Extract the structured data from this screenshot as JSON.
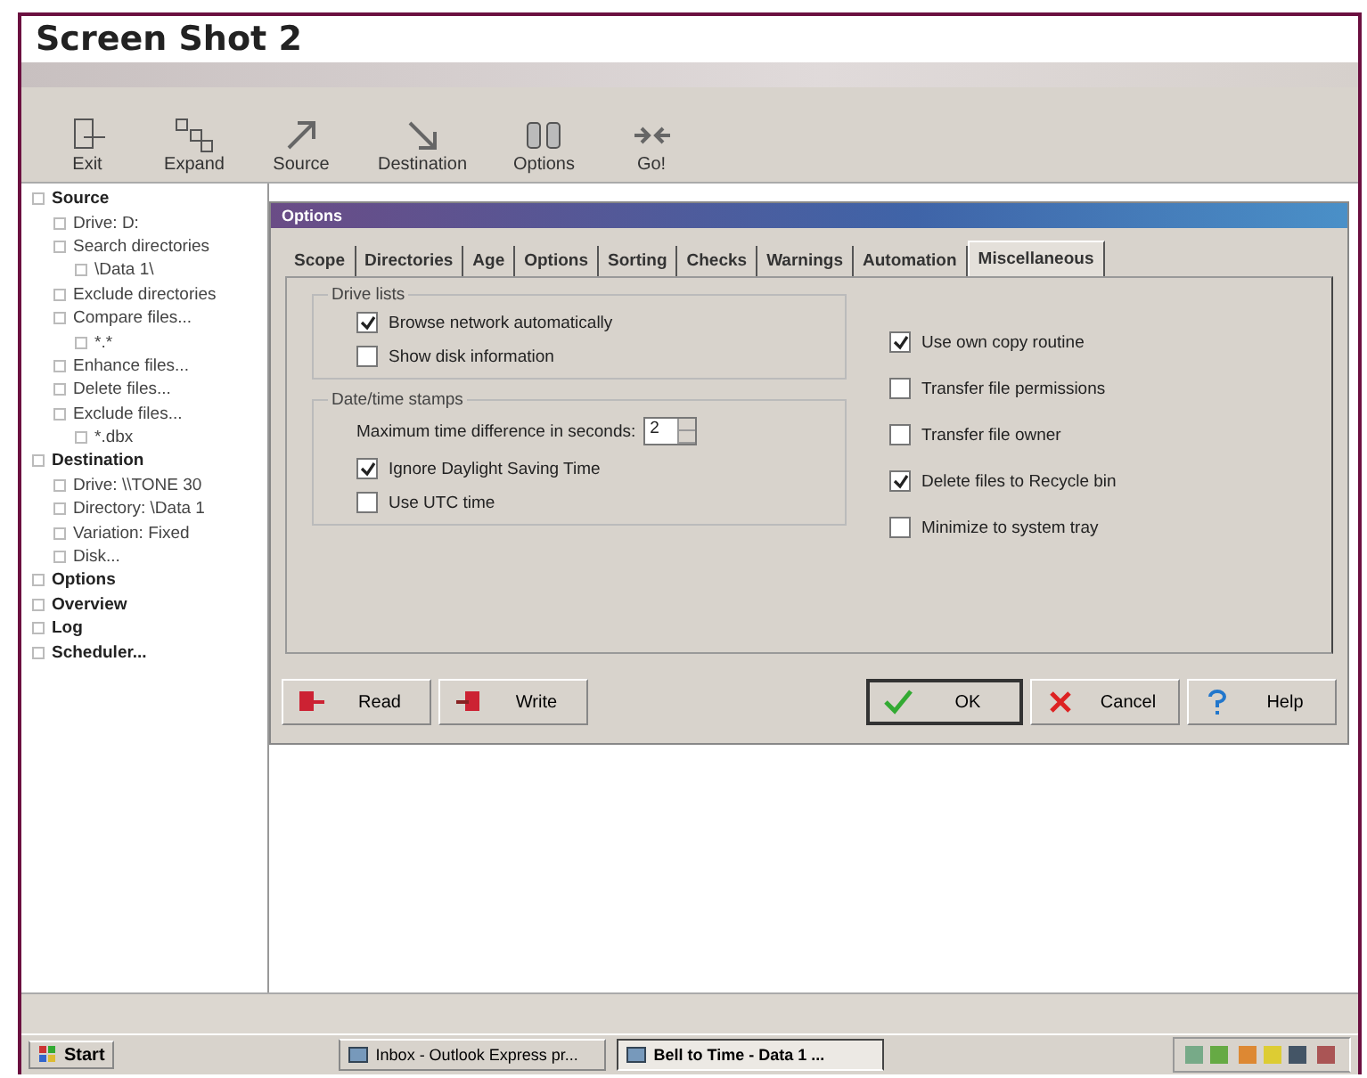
{
  "frame_title": "Screen Shot 2",
  "toolbar": [
    {
      "label": "Exit"
    },
    {
      "label": "Expand"
    },
    {
      "label": "Source"
    },
    {
      "label": "Destination"
    },
    {
      "label": "Options"
    },
    {
      "label": "Go!"
    }
  ],
  "tree": [
    {
      "label": "Source",
      "children": [
        {
          "label": "Drive: D:"
        },
        {
          "label": "Search directories",
          "children": [
            {
              "label": "\\Data 1\\"
            }
          ]
        },
        {
          "label": "Exclude directories"
        },
        {
          "label": "Compare files...",
          "children": [
            {
              "label": "*.*"
            }
          ]
        },
        {
          "label": "Enhance files..."
        },
        {
          "label": "Delete files..."
        },
        {
          "label": "Exclude files...",
          "children": [
            {
              "label": "*.dbx"
            }
          ]
        }
      ]
    },
    {
      "label": "Destination",
      "children": [
        {
          "label": "Drive: \\\\TONE 30"
        },
        {
          "label": "Directory: \\Data 1"
        },
        {
          "label": "Variation: Fixed"
        },
        {
          "label": "Disk..."
        }
      ]
    },
    {
      "label": "Options"
    },
    {
      "label": "Overview"
    },
    {
      "label": "Log"
    },
    {
      "label": "Scheduler..."
    }
  ],
  "dialog": {
    "title": "Options",
    "tabs": [
      {
        "label": "Scope",
        "selected": false
      },
      {
        "label": "Directories",
        "selected": false
      },
      {
        "label": "Age",
        "selected": false
      },
      {
        "label": "Options",
        "selected": false
      },
      {
        "label": "Sorting",
        "selected": false
      },
      {
        "label": "Checks",
        "selected": false
      },
      {
        "label": "Warnings",
        "selected": false
      },
      {
        "label": "Automation",
        "selected": false
      },
      {
        "label": "Miscellaneous",
        "selected": true
      }
    ],
    "groups": [
      {
        "title": "Drive lists",
        "items": [
          {
            "kind": "checkbox",
            "label": "Browse network automatically",
            "checked": true
          },
          {
            "kind": "checkbox",
            "label": "Show disk information",
            "checked": false
          }
        ]
      },
      {
        "title": "Date/time stamps",
        "items": [
          {
            "kind": "spin",
            "label": "Maximum time difference in seconds:",
            "value": "2"
          },
          {
            "kind": "checkbox",
            "label": "Ignore Daylight Saving Time",
            "checked": true
          },
          {
            "kind": "checkbox",
            "label": "Use UTC time",
            "checked": false
          }
        ]
      }
    ],
    "right_options": [
      {
        "label": "Use own copy routine",
        "checked": true
      },
      {
        "label": "Transfer file permissions",
        "checked": false
      },
      {
        "label": "Transfer file owner",
        "checked": false
      },
      {
        "label": "Delete files to Recycle bin",
        "checked": true
      },
      {
        "label": "Minimize to system tray",
        "checked": false
      }
    ],
    "buttons": [
      {
        "label": "Read",
        "default": false
      },
      {
        "label": "Write",
        "default": false
      },
      {
        "label": "OK",
        "default": true
      },
      {
        "label": "Cancel",
        "default": false
      },
      {
        "label": "Help",
        "default": false
      }
    ]
  },
  "taskbar": {
    "start": "Start",
    "tasks": [
      {
        "label": "Inbox - Outlook Express pr...",
        "selected": false
      },
      {
        "label": "Bell to Time - Data 1 ...",
        "selected": true
      }
    ]
  }
}
